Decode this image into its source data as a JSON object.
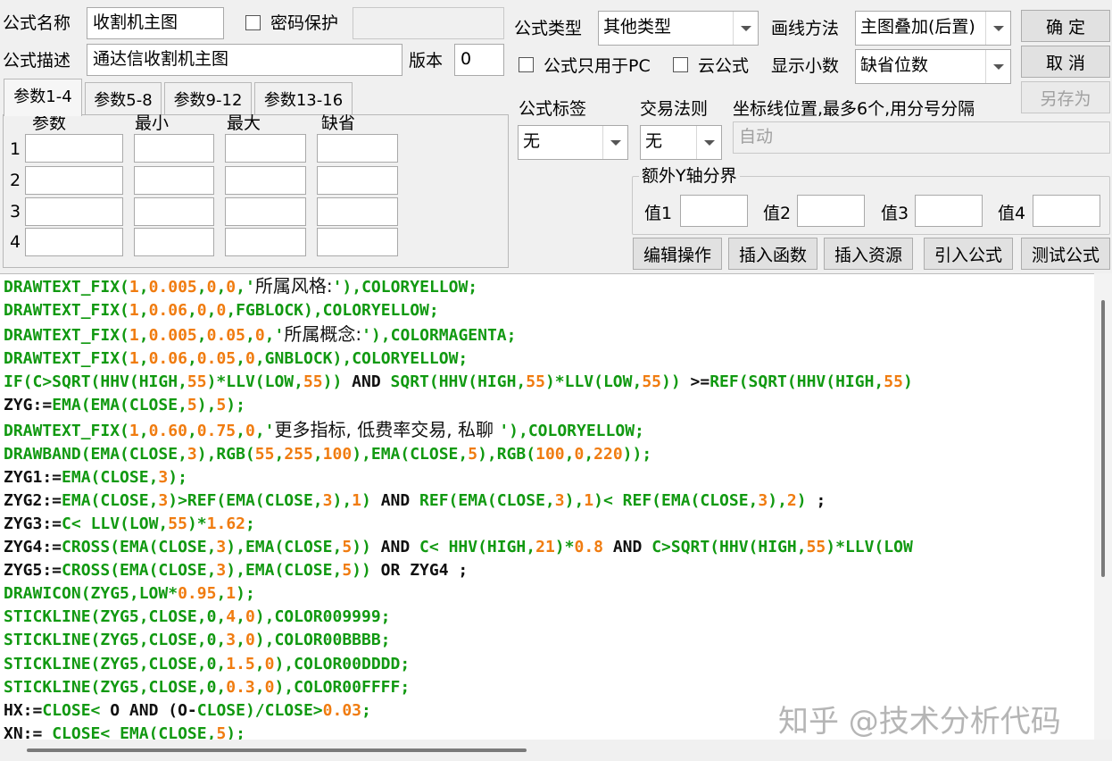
{
  "formula": {
    "name_label": "公式名称",
    "name_value": "收割机主图",
    "password_label": "密码保护",
    "password_value": "",
    "desc_label": "公式描述",
    "desc_value": "通达信收割机主图",
    "version_label": "版本",
    "version_value": "0"
  },
  "right_top": {
    "type_label": "公式类型",
    "type_value": "其他类型",
    "draw_label": "画线方法",
    "draw_value": "主图叠加(后置)",
    "pc_only_label": "公式只用于PC",
    "cloud_label": "云公式",
    "decimals_label": "显示小数",
    "decimals_value": "缺省位数"
  },
  "buttons": {
    "ok": "确  定",
    "cancel": "取  消",
    "save_as": "另存为",
    "edit": "编辑操作",
    "insert_func": "插入函数",
    "insert_res": "插入资源",
    "import_formula": "引入公式",
    "test_formula": "测试公式"
  },
  "tabs": [
    "参数1-4",
    "参数5-8",
    "参数9-12",
    "参数13-16"
  ],
  "params": {
    "headers": [
      "参数",
      "最小",
      "最大",
      "缺省"
    ],
    "rows": [
      "1",
      "2",
      "3",
      "4"
    ]
  },
  "mid": {
    "tag_label": "公式标签",
    "tag_value": "无",
    "trade_label": "交易法则",
    "trade_value": "无",
    "coord_label": "坐标线位置,最多6个,用分号分隔",
    "coord_placeholder": "自动",
    "yaxis_label": "额外Y轴分界",
    "val_labels": [
      "值1",
      "值2",
      "值3",
      "值4"
    ]
  },
  "code_lines": [
    [
      [
        "k",
        "DRAWTEXT_FIX("
      ],
      [
        "n",
        "1"
      ],
      [
        "k",
        ","
      ],
      [
        "n",
        "0.005"
      ],
      [
        "k",
        ","
      ],
      [
        "n",
        "0"
      ],
      [
        "k",
        ","
      ],
      [
        "n",
        "0"
      ],
      [
        "k",
        ",'"
      ],
      [
        "s",
        "所属风格:"
      ],
      [
        "k",
        "'),COLORYELLOW;"
      ]
    ],
    [
      [
        "k",
        "DRAWTEXT_FIX("
      ],
      [
        "n",
        "1"
      ],
      [
        "k",
        ","
      ],
      [
        "n",
        "0.06"
      ],
      [
        "k",
        ","
      ],
      [
        "n",
        "0"
      ],
      [
        "k",
        ","
      ],
      [
        "n",
        "0"
      ],
      [
        "k",
        ",FGBLOCK),COLORYELLOW;"
      ]
    ],
    [
      [
        "k",
        "DRAWTEXT_FIX("
      ],
      [
        "n",
        "1"
      ],
      [
        "k",
        ","
      ],
      [
        "n",
        "0.005"
      ],
      [
        "k",
        ","
      ],
      [
        "n",
        "0.05"
      ],
      [
        "k",
        ","
      ],
      [
        "n",
        "0"
      ],
      [
        "k",
        ",'"
      ],
      [
        "s",
        "所属概念:"
      ],
      [
        "k",
        "'),COLORMAGENTA;"
      ]
    ],
    [
      [
        "k",
        "DRAWTEXT_FIX("
      ],
      [
        "n",
        "1"
      ],
      [
        "k",
        ","
      ],
      [
        "n",
        "0.06"
      ],
      [
        "k",
        ","
      ],
      [
        "n",
        "0.05"
      ],
      [
        "k",
        ","
      ],
      [
        "n",
        "0"
      ],
      [
        "k",
        ",GNBLOCK),COLORYELLOW;"
      ]
    ],
    [
      [
        "k",
        "IF(C>SQRT(HHV(HIGH,"
      ],
      [
        "n",
        "55"
      ],
      [
        "k",
        ")*LLV(LOW,"
      ],
      [
        "n",
        "55"
      ],
      [
        "k",
        "))"
      ],
      [
        "v",
        " AND "
      ],
      [
        "k",
        "SQRT(HHV(HIGH,"
      ],
      [
        "n",
        "55"
      ],
      [
        "k",
        ")*LLV(LOW,"
      ],
      [
        "n",
        "55"
      ],
      [
        "k",
        "))"
      ],
      [
        "v",
        " >="
      ],
      [
        "k",
        "REF(SQRT(HHV(HIGH,"
      ],
      [
        "n",
        "55"
      ],
      [
        "k",
        ")"
      ]
    ],
    [
      [
        "v",
        "ZYG:="
      ],
      [
        "k",
        "EMA(EMA(CLOSE,"
      ],
      [
        "n",
        "5"
      ],
      [
        "k",
        "),"
      ],
      [
        "n",
        "5"
      ],
      [
        "k",
        ");"
      ]
    ],
    [
      [
        "k",
        "DRAWTEXT_FIX("
      ],
      [
        "n",
        "1"
      ],
      [
        "k",
        ","
      ],
      [
        "n",
        "0.60"
      ],
      [
        "k",
        ","
      ],
      [
        "n",
        "0.75"
      ],
      [
        "k",
        ","
      ],
      [
        "n",
        "0"
      ],
      [
        "k",
        ",'"
      ],
      [
        "s",
        "更多指标, 低费率交易, 私聊 "
      ],
      [
        "k",
        "'),COLORYELLOW;"
      ]
    ],
    [
      [
        "k",
        "DRAWBAND(EMA(CLOSE,"
      ],
      [
        "n",
        "3"
      ],
      [
        "k",
        "),RGB("
      ],
      [
        "n",
        "55"
      ],
      [
        "k",
        ","
      ],
      [
        "n",
        "255"
      ],
      [
        "k",
        ","
      ],
      [
        "n",
        "100"
      ],
      [
        "k",
        "),EMA(CLOSE,"
      ],
      [
        "n",
        "5"
      ],
      [
        "k",
        "),RGB("
      ],
      [
        "n",
        "100"
      ],
      [
        "k",
        ","
      ],
      [
        "n",
        "0"
      ],
      [
        "k",
        ","
      ],
      [
        "n",
        "220"
      ],
      [
        "k",
        "));"
      ]
    ],
    [
      [
        "v",
        "ZYG1:="
      ],
      [
        "k",
        "EMA(CLOSE,"
      ],
      [
        "n",
        "3"
      ],
      [
        "k",
        ");"
      ]
    ],
    [
      [
        "v",
        "ZYG2:="
      ],
      [
        "k",
        "EMA(CLOSE,"
      ],
      [
        "n",
        "3"
      ],
      [
        "k",
        ")>REF(EMA(CLOSE,"
      ],
      [
        "n",
        "3"
      ],
      [
        "k",
        "),"
      ],
      [
        "n",
        "1"
      ],
      [
        "k",
        ")"
      ],
      [
        "v",
        " AND "
      ],
      [
        "k",
        "REF(EMA(CLOSE,"
      ],
      [
        "n",
        "3"
      ],
      [
        "k",
        "),"
      ],
      [
        "n",
        "1"
      ],
      [
        "k",
        ")<"
      ],
      [
        "v",
        " "
      ],
      [
        "k",
        "REF(EMA(CLOSE,"
      ],
      [
        "n",
        "3"
      ],
      [
        "k",
        "),"
      ],
      [
        "n",
        "2"
      ],
      [
        "k",
        ")"
      ],
      [
        "v",
        " ;"
      ]
    ],
    [
      [
        "v",
        "ZYG3:="
      ],
      [
        "k",
        "C<"
      ],
      [
        "v",
        " "
      ],
      [
        "k",
        "LLV(LOW,"
      ],
      [
        "n",
        "55"
      ],
      [
        "k",
        ")*"
      ],
      [
        "n",
        "1.62"
      ],
      [
        "k",
        ";"
      ]
    ],
    [
      [
        "v",
        "ZYG4:="
      ],
      [
        "k",
        "CROSS(EMA(CLOSE,"
      ],
      [
        "n",
        "3"
      ],
      [
        "k",
        "),EMA(CLOSE,"
      ],
      [
        "n",
        "5"
      ],
      [
        "k",
        "))"
      ],
      [
        "v",
        " AND "
      ],
      [
        "k",
        "C<"
      ],
      [
        "v",
        " "
      ],
      [
        "k",
        "HHV(HIGH,"
      ],
      [
        "n",
        "21"
      ],
      [
        "k",
        ")*"
      ],
      [
        "n",
        "0.8"
      ],
      [
        "v",
        " AND "
      ],
      [
        "k",
        "C>SQRT(HHV(HIGH,"
      ],
      [
        "n",
        "55"
      ],
      [
        "k",
        ")*LLV(LOW"
      ]
    ],
    [
      [
        "v",
        "ZYG5:="
      ],
      [
        "k",
        "CROSS(EMA(CLOSE,"
      ],
      [
        "n",
        "3"
      ],
      [
        "k",
        "),EMA(CLOSE,"
      ],
      [
        "n",
        "5"
      ],
      [
        "k",
        "))"
      ],
      [
        "v",
        " OR ZYG4 ;"
      ]
    ],
    [
      [
        "k",
        "DRAWICON(ZYG5,LOW*"
      ],
      [
        "n",
        "0.95"
      ],
      [
        "k",
        ","
      ],
      [
        "n",
        "1"
      ],
      [
        "k",
        ");"
      ]
    ],
    [
      [
        "k",
        "STICKLINE(ZYG5,CLOSE,0,"
      ],
      [
        "n",
        "4"
      ],
      [
        "k",
        ","
      ],
      [
        "n",
        "0"
      ],
      [
        "k",
        "),COLOR009999;"
      ]
    ],
    [
      [
        "k",
        "STICKLINE(ZYG5,CLOSE,0,"
      ],
      [
        "n",
        "3"
      ],
      [
        "k",
        ","
      ],
      [
        "n",
        "0"
      ],
      [
        "k",
        "),COLOR00BBBB;"
      ]
    ],
    [
      [
        "k",
        "STICKLINE(ZYG5,CLOSE,0,"
      ],
      [
        "n",
        "1.5"
      ],
      [
        "k",
        ","
      ],
      [
        "n",
        "0"
      ],
      [
        "k",
        "),COLOR00DDDD;"
      ]
    ],
    [
      [
        "k",
        "STICKLINE(ZYG5,CLOSE,0,"
      ],
      [
        "n",
        "0.3"
      ],
      [
        "k",
        ","
      ],
      [
        "n",
        "0"
      ],
      [
        "k",
        "),COLOR00FFFF;"
      ]
    ],
    [
      [
        "v",
        "HX:="
      ],
      [
        "k",
        "CLOSE<"
      ],
      [
        "v",
        " O AND (O-"
      ],
      [
        "k",
        "CLOSE)/CLOSE>"
      ],
      [
        "n",
        "0.03"
      ],
      [
        "k",
        ";"
      ]
    ],
    [
      [
        "v",
        "XN:= "
      ],
      [
        "k",
        "CLOSE<"
      ],
      [
        "v",
        " "
      ],
      [
        "k",
        "EMA(CLOSE,"
      ],
      [
        "n",
        "5"
      ],
      [
        "k",
        ");"
      ]
    ]
  ],
  "watermark": "知乎 @技术分析代码"
}
